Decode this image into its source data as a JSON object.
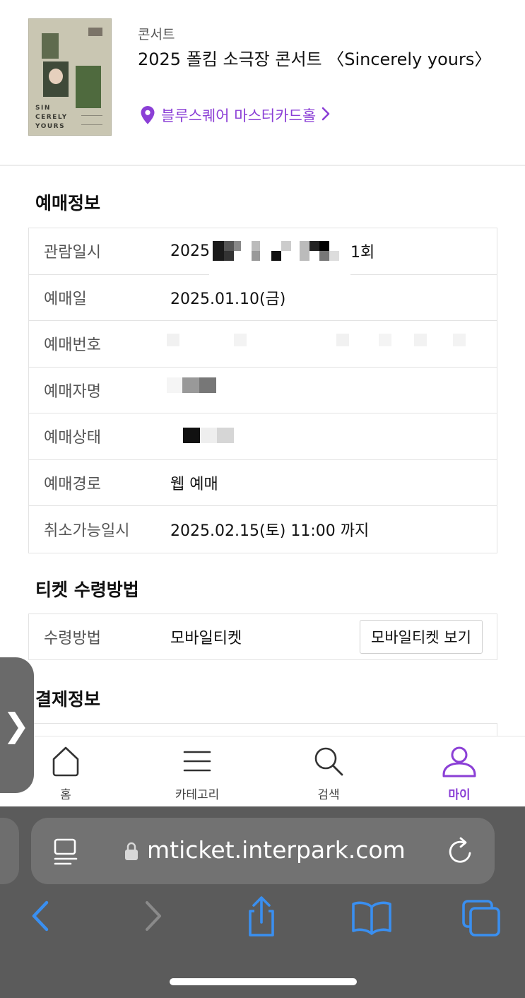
{
  "event": {
    "category": "콘서트",
    "title": "2025 폴킴 소극장 콘서트 〈Sincerely yours〉",
    "venue": "블루스퀘어 마스터카드홀",
    "poster_text": [
      "SIN",
      "CERELY",
      "YOURS"
    ]
  },
  "booking_info": {
    "title": "예매정보",
    "rows": [
      {
        "label": "관람일시",
        "value_start": "2025",
        "value_end": "1회"
      },
      {
        "label": "예매일",
        "value": "2025.01.10(금)"
      },
      {
        "label": "예매번호",
        "value": ""
      },
      {
        "label": "예매자명",
        "value": ""
      },
      {
        "label": "예매상태",
        "value": ""
      },
      {
        "label": "예매경로",
        "value": "웹 예매"
      },
      {
        "label": "취소가능일시",
        "value": "2025.02.15(토) 11:00 까지"
      }
    ]
  },
  "ticket_pickup": {
    "title": "티켓 수령방법",
    "label": "수령방법",
    "value": "모바일티켓",
    "button": "모바일티켓 보기"
  },
  "payment": {
    "title": "결제정보"
  },
  "bottom_nav": {
    "items": [
      {
        "label": "홈",
        "icon": "home-icon"
      },
      {
        "label": "카테고리",
        "icon": "menu-icon"
      },
      {
        "label": "검색",
        "icon": "search-icon"
      },
      {
        "label": "마이",
        "icon": "person-icon",
        "active": true
      }
    ]
  },
  "browser": {
    "url": "mticket.interpark.com"
  },
  "colors": {
    "accent": "#8b3fd6",
    "ios_blue": "#3a8ff0",
    "browser_bg": "#5b5b5b"
  }
}
